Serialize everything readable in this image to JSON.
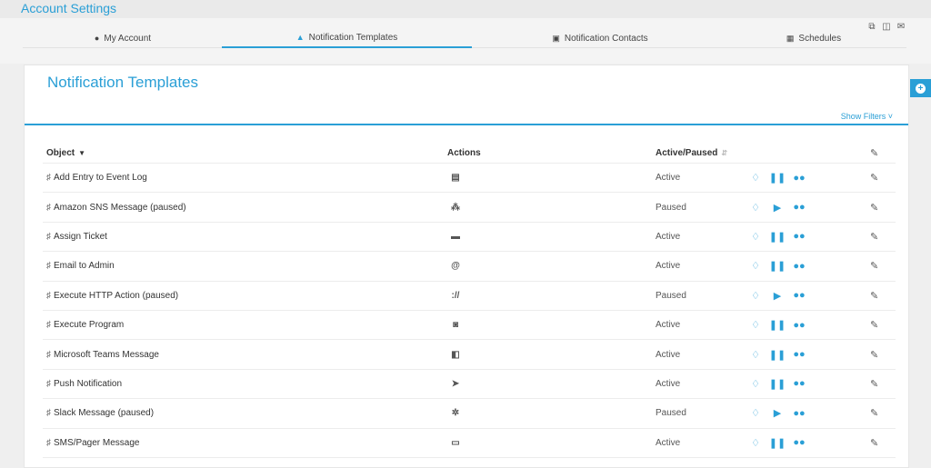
{
  "app": {
    "title": "Account Settings"
  },
  "tabs": [
    {
      "label": "My Account",
      "icon": "user-icon",
      "glyph": "👤",
      "active": false
    },
    {
      "label": "Notification Templates",
      "icon": "bell-icon",
      "glyph": "🔔",
      "active": true
    },
    {
      "label": "Notification Contacts",
      "icon": "contact-card-icon",
      "glyph": "▣",
      "active": false
    },
    {
      "label": "Schedules",
      "icon": "calendar-icon",
      "glyph": "▦",
      "active": false
    }
  ],
  "top_tools": [
    {
      "icon": "copy-icon",
      "glyph": "⎘"
    },
    {
      "icon": "add-file-icon",
      "glyph": "🗋"
    },
    {
      "icon": "envelope-icon",
      "glyph": "✉"
    }
  ],
  "side_button": {
    "icon": "plus-circle-icon",
    "glyph": "+"
  },
  "panel": {
    "title": "Notification Templates",
    "filters_label": "Show Filters ˅"
  },
  "table": {
    "headers": {
      "object": "Object",
      "actions": "Actions",
      "state": "Active/Paused"
    },
    "rows": [
      {
        "name": "Add Entry to Event Log",
        "action_icon": "event-log-icon",
        "action_glyph": "▤",
        "state": "Active",
        "toggle": "pause"
      },
      {
        "name": "Amazon SNS Message (paused)",
        "action_icon": "sns-icon",
        "action_glyph": "⁂",
        "state": "Paused",
        "toggle": "play"
      },
      {
        "name": "Assign Ticket",
        "action_icon": "ticket-icon",
        "action_glyph": "▬",
        "state": "Active",
        "toggle": "pause"
      },
      {
        "name": "Email to Admin",
        "action_icon": "at-icon",
        "action_glyph": "@",
        "state": "Active",
        "toggle": "pause"
      },
      {
        "name": "Execute HTTP Action (paused)",
        "action_icon": "http-icon",
        "action_glyph": "://",
        "state": "Paused",
        "toggle": "play"
      },
      {
        "name": "Execute Program",
        "action_icon": "program-icon",
        "action_glyph": "◙",
        "state": "Active",
        "toggle": "pause"
      },
      {
        "name": "Microsoft Teams Message",
        "action_icon": "teams-icon",
        "action_glyph": "◧",
        "state": "Active",
        "toggle": "pause"
      },
      {
        "name": "Push Notification",
        "action_icon": "send-icon",
        "action_glyph": "➤",
        "state": "Active",
        "toggle": "pause"
      },
      {
        "name": "Slack Message (paused)",
        "action_icon": "slack-icon",
        "action_glyph": "✲",
        "state": "Paused",
        "toggle": "play"
      },
      {
        "name": "SMS/Pager Message",
        "action_icon": "sms-icon",
        "action_glyph": "▭",
        "state": "Active",
        "toggle": "pause"
      }
    ]
  },
  "glyphs": {
    "bell": "🔔",
    "bell_outline": "♫",
    "pause": "❚❚",
    "play": "▶",
    "users": "👥",
    "edit": "✎",
    "caret_down": "▾",
    "sort": "⇕"
  },
  "colors": {
    "accent": "#2a9fd6"
  }
}
